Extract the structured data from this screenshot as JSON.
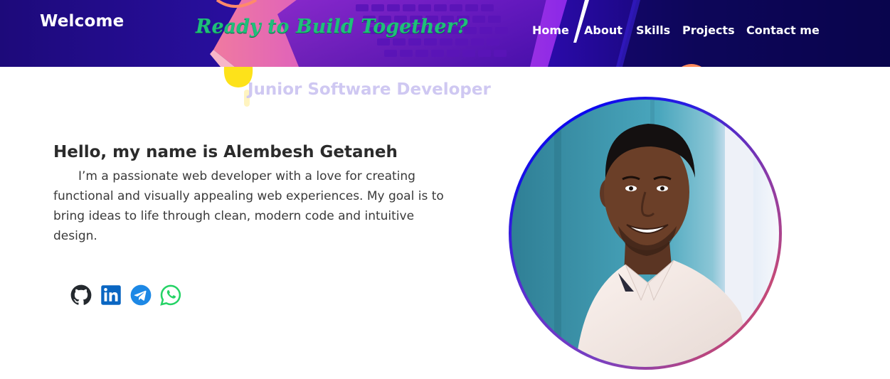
{
  "header": {
    "brand": "Welcome",
    "tagline": "Ready to Build Together?",
    "nav": {
      "home": "Home",
      "about": "About",
      "skills": "Skills",
      "projects": "Projects",
      "contact": "Contact me"
    }
  },
  "hero": {
    "subtitle": "Junior Software Developer",
    "greeting": "Hello, my name is Alembesh Getaneh",
    "bio": "I’m a passionate web developer with a love for creating functional and visually appealing web experiences. My goal is to bring ideas to life through clean, modern code and intuitive design."
  },
  "socials": [
    {
      "icon": "github-icon",
      "color": "#24292e"
    },
    {
      "icon": "linkedin-icon",
      "color": "#0a66c2"
    },
    {
      "icon": "telegram-icon",
      "color": "#1d88e5"
    },
    {
      "icon": "whatsapp-icon",
      "color": "#25d366"
    }
  ],
  "colors": {
    "header_bg": "#2a0fa3",
    "tagline": "#1fbf7a",
    "subtitle": "#cfc8f2",
    "ring_start": "#c44a78",
    "ring_end": "#0a06f0"
  }
}
